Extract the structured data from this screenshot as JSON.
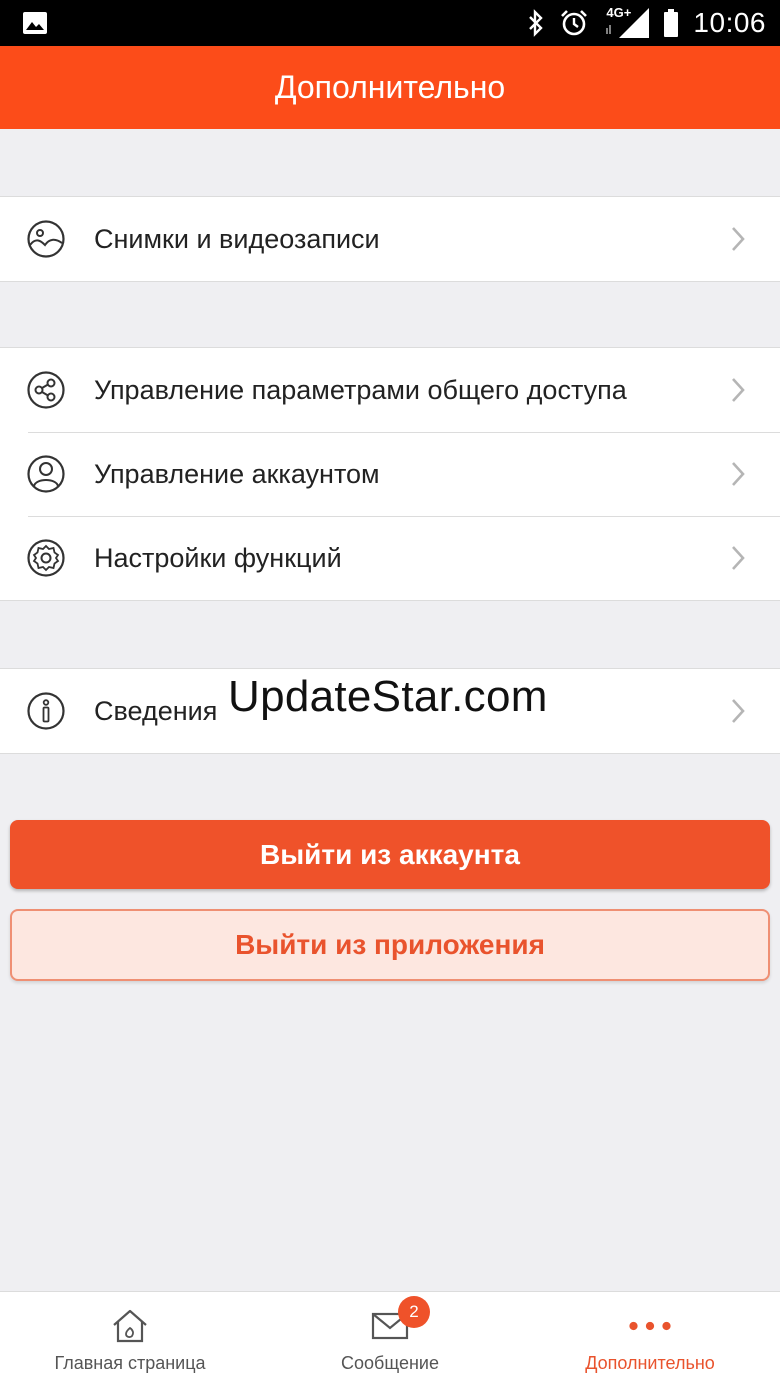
{
  "status_bar": {
    "time": "10:06",
    "network": "4G+",
    "icons": [
      "image-icon",
      "bluetooth-icon",
      "alarm-icon",
      "signal-icon",
      "battery-icon"
    ]
  },
  "header": {
    "title": "Дополнительно"
  },
  "menu": {
    "group1": [
      {
        "label": "Снимки и видеозаписи",
        "icon": "gallery-icon"
      }
    ],
    "group2": [
      {
        "label": "Управление параметрами общего доступа",
        "icon": "share-icon"
      },
      {
        "label": "Управление аккаунтом",
        "icon": "account-icon"
      },
      {
        "label": "Настройки функций",
        "icon": "settings-icon"
      }
    ],
    "group3": [
      {
        "label": "Сведения",
        "icon": "info-icon"
      }
    ]
  },
  "watermark": "UpdateStar.com",
  "buttons": {
    "logout": "Выйти из аккаунта",
    "exit_app": "Выйти из приложения"
  },
  "bottom_nav": {
    "items": [
      {
        "label": "Главная страница",
        "icon": "home-icon",
        "active": false
      },
      {
        "label": "Сообщение",
        "icon": "mail-icon",
        "active": false,
        "badge": "2"
      },
      {
        "label": "Дополнительно",
        "icon": "more-icon",
        "active": true
      }
    ]
  },
  "colors": {
    "accent": "#fc4c19",
    "button_primary": "#ef522a",
    "button_secondary_bg": "#fde7e0",
    "background": "#efeff2"
  }
}
